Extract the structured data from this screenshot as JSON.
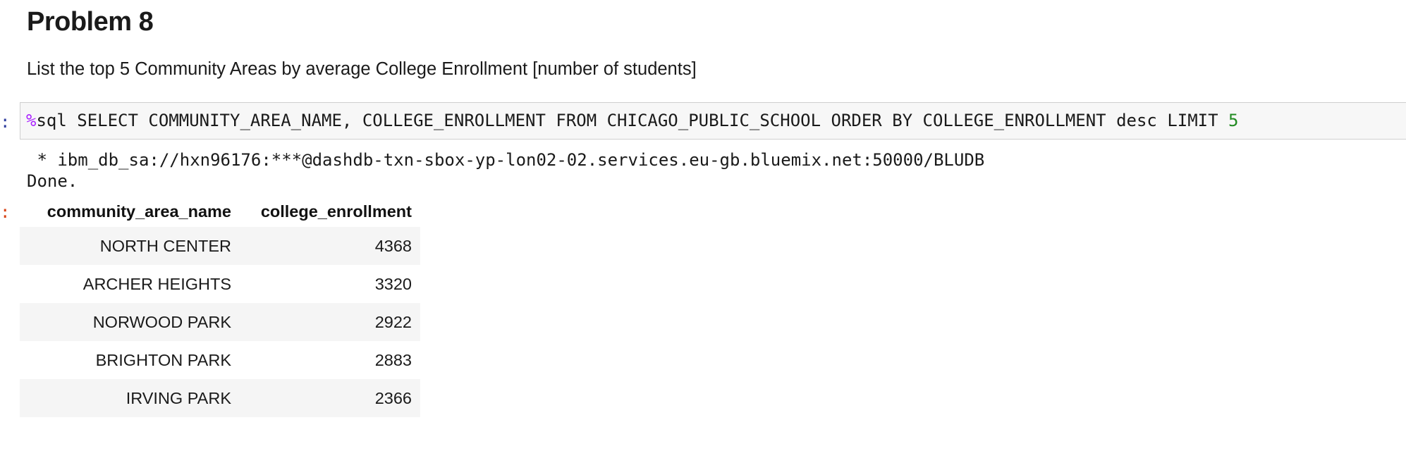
{
  "markdown": {
    "title": "Problem 8",
    "description": "List the top 5 Community Areas by average College Enrollment [number of students]"
  },
  "cell": {
    "input_prompt": ":",
    "output_prompt": ":",
    "code": {
      "magic": "%",
      "statement": "sql SELECT COMMUNITY_AREA_NAME, COLLEGE_ENROLLMENT FROM CHICAGO_PUBLIC_SCHOOL ORDER BY COLLEGE_ENROLLMENT desc LIMIT ",
      "limit_value": "5"
    },
    "stdout": {
      "connection_line": " * ibm_db_sa://hxn96176:***@dashdb-txn-sbox-yp-lon02-02.services.eu-gb.bluemix.net:50000/BLUDB",
      "status_line": "Done."
    }
  },
  "result_table": {
    "columns": [
      "community_area_name",
      "college_enrollment"
    ],
    "rows": [
      [
        "NORTH CENTER",
        "4368"
      ],
      [
        "ARCHER HEIGHTS",
        "3320"
      ],
      [
        "NORWOOD PARK",
        "2922"
      ],
      [
        "BRIGHTON PARK",
        "2883"
      ],
      [
        "IRVING PARK",
        "2366"
      ]
    ]
  }
}
